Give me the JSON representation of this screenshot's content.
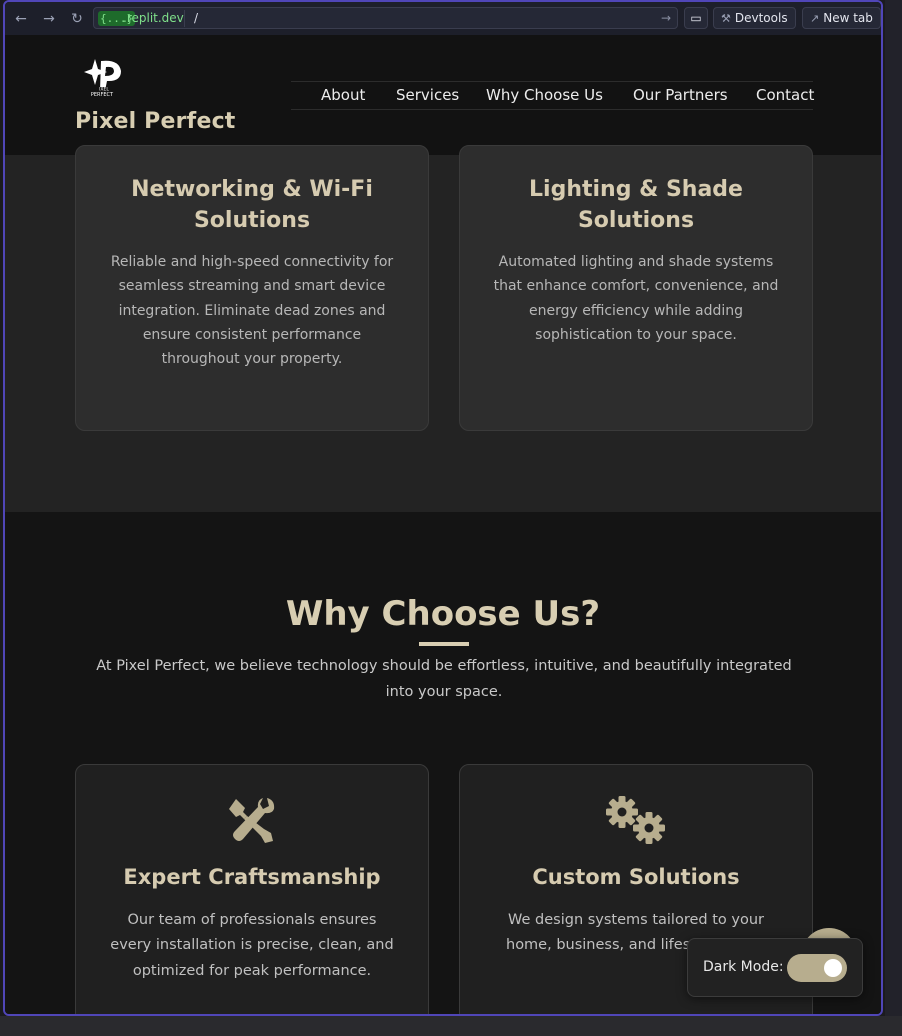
{
  "browser": {
    "url_chip": "{...}",
    "url_host": ".replit.dev",
    "url_path": "/",
    "devtools_label": "Devtools",
    "new_tab_label": "New tab"
  },
  "header": {
    "brand": "Pixel Perfect",
    "nav": [
      "About",
      "Services",
      "Why Choose Us",
      "Our Partners",
      "Contact"
    ]
  },
  "services": [
    {
      "title_line1": "Networking & Wi-Fi",
      "title_line2": "Solutions",
      "lines": [
        "Reliable and high-speed connectivity for",
        "seamless streaming and smart device",
        "integration. Eliminate dead zones and",
        "ensure consistent performance",
        "throughout your property."
      ]
    },
    {
      "title_line1": "Lighting & Shade",
      "title_line2": "Solutions",
      "lines": [
        "Automated lighting and shade systems",
        "that enhance comfort, convenience, and",
        "energy efficiency while adding",
        "sophistication to your space."
      ]
    }
  ],
  "why": {
    "title": "Why Choose Us?",
    "subtitle_line1": "At Pixel Perfect, we believe technology should be effortless, intuitive, and beautifully integrated",
    "subtitle_line2": "into your space.",
    "cards": [
      {
        "icon": "tools-icon",
        "title": "Expert Craftsmanship",
        "lines": [
          "Our team of professionals ensures",
          "every installation is precise, clean, and",
          "optimized for peak performance."
        ]
      },
      {
        "icon": "gears-icon",
        "title": "Custom Solutions",
        "lines": [
          "We design systems tailored to your",
          "home, business, and lifes"
        ]
      }
    ]
  },
  "dark_mode": {
    "label": "Dark Mode:",
    "enabled": true
  },
  "colors": {
    "accent": "#d8ceb2",
    "toggle": "#b7ad8e",
    "browser_border": "#5046b8"
  }
}
